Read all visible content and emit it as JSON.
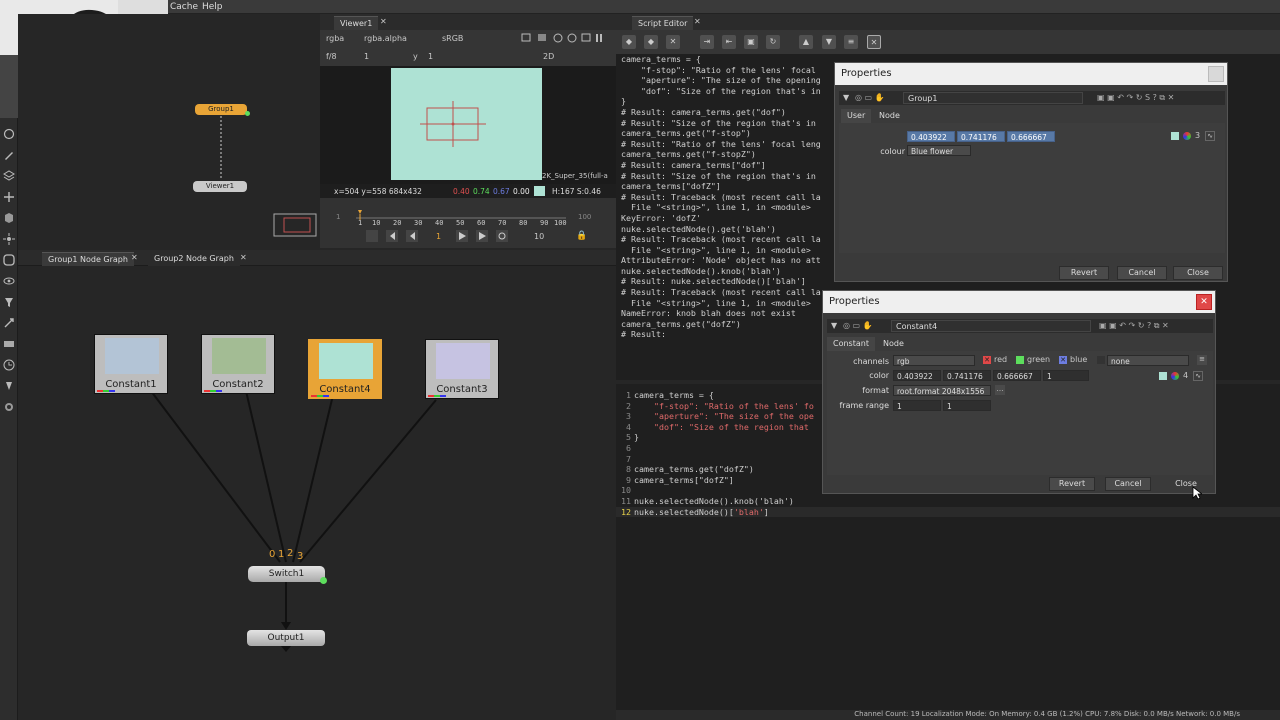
{
  "menu": {
    "cache": "Cache",
    "help": "Help"
  },
  "viewer": {
    "tab": "Viewer1",
    "channels": "rgba",
    "alpha": "rgba.alpha",
    "colorspace": "sRGB",
    "fstop": "f/8",
    "frame_label": "1",
    "y_label": "y",
    "y_value": "1",
    "view_mode": "2D",
    "format_label": "2K_Super_35(full-a",
    "coords": "x=504 y=558 684x432",
    "pixel_r": "0.40",
    "pixel_g": "0.74",
    "pixel_b": "0.67",
    "pixel_a": "0.00",
    "hsv": "H:167 S:0.46",
    "timeline_ticks": [
      "1",
      "10",
      "20",
      "30",
      "40",
      "50",
      "60",
      "70",
      "80",
      "90",
      "100"
    ],
    "timeline_start": "1",
    "timeline_end": "100",
    "current_frame": "1",
    "step": "10"
  },
  "mini_graph": {
    "group_node": "Group1",
    "viewer_node": "Viewer1"
  },
  "node_graph": {
    "tabs": [
      "Group1 Node Graph",
      "Group2 Node Graph"
    ],
    "constants": [
      {
        "label": "Constant1",
        "color": "#b3c4d6"
      },
      {
        "label": "Constant2",
        "color": "#a3bc94"
      },
      {
        "label": "Constant4",
        "color": "#aee2d4"
      },
      {
        "label": "Constant3",
        "color": "#c6c3e2"
      }
    ],
    "switch_inputs": [
      "0",
      "1",
      "2",
      "3"
    ],
    "switch": "Switch1",
    "output": "Output1"
  },
  "script_editor": {
    "tab": "Script Editor",
    "output_lines": [
      "camera_terms = {",
      "    \"f-stop\": \"Ratio of the lens' focal",
      "    \"aperture\": \"The size of the opening",
      "    \"dof\": \"Size of the region that's in",
      "}",
      "# Result: camera_terms.get(\"dof\")",
      "# Result: \"Size of the region that's in",
      "camera_terms.get(\"f-stop\")",
      "# Result: \"Ratio of the lens' focal leng",
      "camera_terms.get(\"f-stopZ\")",
      "# Result: camera_terms[\"dof\"]",
      "# Result: \"Size of the region that's in",
      "camera_terms[\"dofZ\"]",
      "# Result: Traceback (most recent call la",
      "  File \"<string>\", line 1, in <module>",
      "KeyError: 'dofZ'",
      "nuke.selectedNode().get('blah')",
      "# Result: Traceback (most recent call la",
      "  File \"<string>\", line 1, in <module>",
      "AttributeError: 'Node' object has no att",
      "nuke.selectedNode().knob('blah')",
      "# Result: nuke.selectedNode()['blah']",
      "# Result: Traceback (most recent call la",
      "  File \"<string>\", line 1, in <module>",
      "NameError: knob blah does not exist",
      "camera_terms.get(\"dofZ\")",
      "# Result:"
    ],
    "input_lines": [
      {
        "n": "1",
        "code": "camera_terms = {",
        "str": ""
      },
      {
        "n": "2",
        "code": "    ",
        "str": "\"f-stop\": \"Ratio of the lens' fo"
      },
      {
        "n": "3",
        "code": "    ",
        "str": "\"aperture\": \"The size of the ope"
      },
      {
        "n": "4",
        "code": "    ",
        "str": "\"dof\": \"Size of the region that"
      },
      {
        "n": "5",
        "code": "}",
        "str": ""
      },
      {
        "n": "6",
        "code": "",
        "str": ""
      },
      {
        "n": "7",
        "code": "",
        "str": ""
      },
      {
        "n": "8",
        "code": "camera_terms.get(\"dofZ\")",
        "str": ""
      },
      {
        "n": "9",
        "code": "camera_terms[\"dofZ\"]",
        "str": ""
      },
      {
        "n": "10",
        "code": "",
        "str": ""
      },
      {
        "n": "11",
        "code": "nuke.selectedNode().knob('blah')",
        "str": ""
      },
      {
        "n": "12",
        "code": "nuke.selectedNode()[",
        "str": "'blah'"
      }
    ],
    "input_line12_close": "]"
  },
  "props_group": {
    "title": "Properties",
    "name": "Group1",
    "tabs": [
      "User",
      "Node"
    ],
    "rgb": [
      "0.403922",
      "0.741176",
      "0.666667"
    ],
    "channel_count": "3",
    "colour_label": "colour",
    "colour_value": "Blue flower",
    "buttons": {
      "revert": "Revert",
      "cancel": "Cancel",
      "close": "Close"
    }
  },
  "props_constant": {
    "title": "Properties",
    "name": "Constant4",
    "tabs": [
      "Constant",
      "Node"
    ],
    "channels_label": "channels",
    "channels_value": "rgb",
    "red": "red",
    "green": "green",
    "blue": "blue",
    "none": "none",
    "color_label": "color",
    "rgba": [
      "0.403922",
      "0.741176",
      "0.666667",
      "1"
    ],
    "channel_count": "4",
    "format_label": "format",
    "format_value": "root.format 2048x1556",
    "frame_range_label": "frame range",
    "frame_range": [
      "1",
      "1"
    ],
    "buttons": {
      "revert": "Revert",
      "cancel": "Cancel",
      "close": "Close"
    }
  },
  "status": {
    "text": "Channel Count: 19  Localization Mode: On  Memory: 0.4 GB (1.2%)  CPU: 7.8%  Disk: 0.0 MB/s  Network: 0.0 MB/s"
  }
}
